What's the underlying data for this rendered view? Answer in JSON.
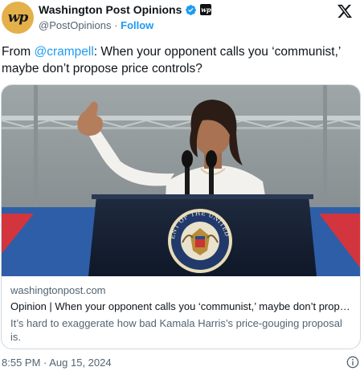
{
  "account": {
    "avatar_text": "wp",
    "name": "Washington Post Opinions",
    "badge_text": "wp",
    "handle": "@PostOpinions",
    "separator": "·",
    "follow_label": "Follow"
  },
  "tweet": {
    "prefix": "From ",
    "mention": "@crampell",
    "body": ": When your opponent calls you ‘communist,’ maybe don’t propose price controls?"
  },
  "card": {
    "domain": "washingtonpost.com",
    "title": "Opinion | When your opponent calls you ‘communist,’ maybe don’t propose price controls?",
    "description": "It’s hard to exaggerate how bad Kamala Harris’s price-gouging proposal is.",
    "seal_text": "PRESIDENT OF THE UNITED STATES"
  },
  "footer": {
    "timestamp": "8:55 PM · Aug 15, 2024"
  },
  "colors": {
    "accent": "#1d9bf0",
    "secondary_text": "#536471",
    "avatar_bg": "#e3b04a"
  },
  "icons": {
    "verified": "verified-badge-icon",
    "x_logo": "x-logo-icon",
    "info": "info-icon"
  }
}
